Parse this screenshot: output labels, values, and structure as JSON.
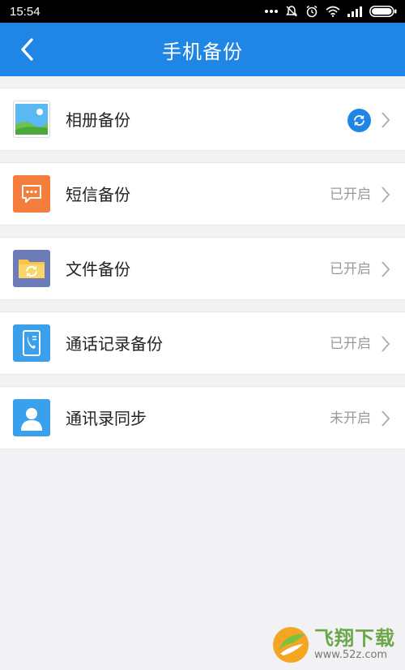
{
  "status_bar": {
    "time": "15:54",
    "icons": [
      "more-dots-icon",
      "alarm-off-icon",
      "alarm-clock-icon",
      "wifi-icon",
      "signal-icon",
      "battery-icon"
    ]
  },
  "header": {
    "title": "手机备份",
    "back_icon": "back-arrow-icon",
    "background": "#1f86e6"
  },
  "backup_items": [
    {
      "label": "相册备份",
      "status": "",
      "icon": "photo-album-icon",
      "icon_color": "#4fb2f0",
      "syncing": true
    },
    {
      "label": "短信备份",
      "status": "已开启",
      "icon": "sms-icon",
      "icon_color": "#f57e3c"
    },
    {
      "label": "文件备份",
      "status": "已开启",
      "icon": "folder-sync-icon",
      "icon_color": "#6d7bb8"
    },
    {
      "label": "通话记录备份",
      "status": "已开启",
      "icon": "call-log-icon",
      "icon_color": "#3aa0ec"
    },
    {
      "label": "通讯录同步",
      "status": "未开启",
      "icon": "contacts-icon",
      "icon_color": "#3aa0ec"
    }
  ],
  "watermark": {
    "name": "飞翔下载",
    "url": "www.52z.com"
  }
}
